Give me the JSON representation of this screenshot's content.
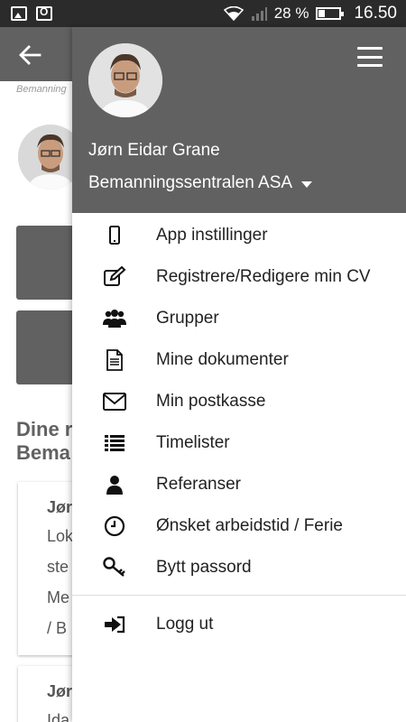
{
  "status_bar": {
    "battery_text": "28 %",
    "time": "16.50",
    "icons": [
      "image-icon",
      "office-icon",
      "wifi-icon",
      "signal-icon",
      "battery-icon"
    ]
  },
  "background_app": {
    "subtitle": "Bemanning",
    "heading_line1": "Dine r",
    "heading_line2": "Bema",
    "card1": {
      "line1": "Jør",
      "line2": "Lok",
      "line3": "ste",
      "line4": "Me",
      "line5": "/ B"
    },
    "card2": {
      "line1": "Jør",
      "line2": "Ida"
    }
  },
  "drawer": {
    "user_name": "Jørn Eidar Grane",
    "company": "Bemanningssentralen ASA",
    "menu": [
      {
        "label": "App instillinger",
        "icon": "phone-icon"
      },
      {
        "label": "Registrere/Redigere min CV",
        "icon": "edit-icon"
      },
      {
        "label": "Grupper",
        "icon": "group-icon"
      },
      {
        "label": "Mine dokumenter",
        "icon": "document-icon"
      },
      {
        "label": "Min postkasse",
        "icon": "envelope-icon"
      },
      {
        "label": "Timelister",
        "icon": "list-icon"
      },
      {
        "label": "Referanser",
        "icon": "person-icon"
      },
      {
        "label": "Ønsket arbeidstid / Ferie",
        "icon": "clock-icon"
      },
      {
        "label": "Bytt passord",
        "icon": "key-icon"
      },
      {
        "label": "Logg ut",
        "icon": "logout-icon"
      }
    ]
  },
  "colors": {
    "header": "#616161",
    "status_bar": "#2b2b2b",
    "text": "#222222"
  }
}
